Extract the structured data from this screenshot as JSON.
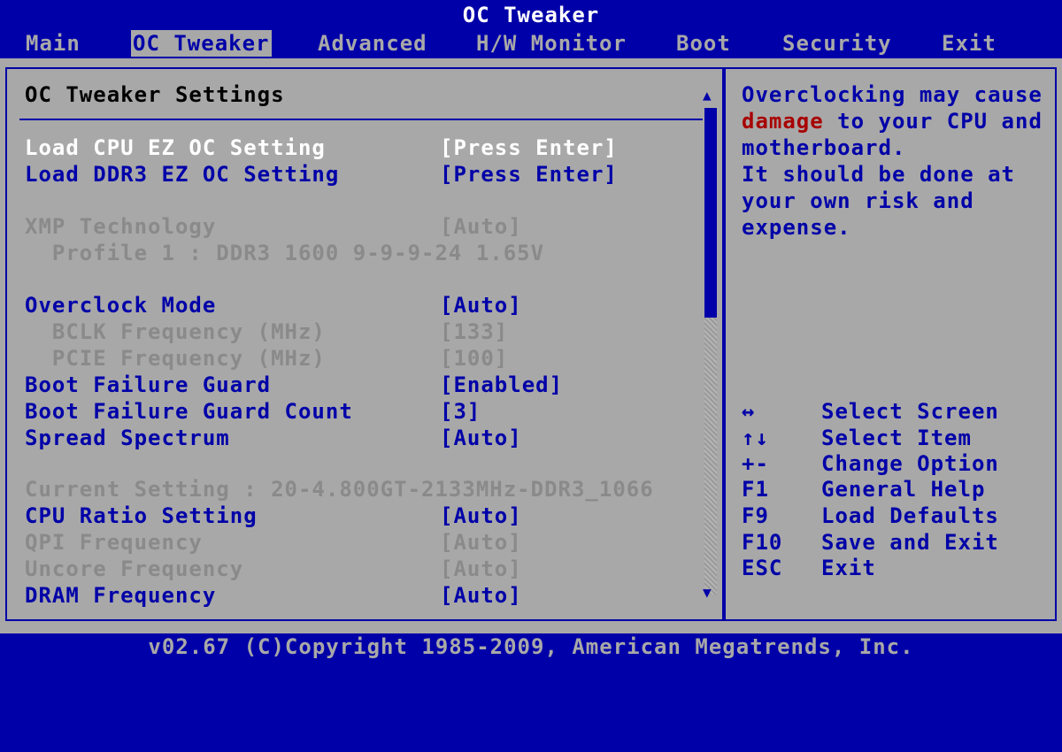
{
  "title": "OC Tweaker",
  "menu": [
    {
      "label": "Main",
      "active": false
    },
    {
      "label": "OC Tweaker",
      "active": true
    },
    {
      "label": "Advanced",
      "active": false
    },
    {
      "label": "H/W Monitor",
      "active": false
    },
    {
      "label": "Boot",
      "active": false
    },
    {
      "label": "Security",
      "active": false
    },
    {
      "label": "Exit",
      "active": false
    }
  ],
  "section_title": "OC Tweaker Settings",
  "settings": [
    {
      "label": "Load CPU EZ OC Setting",
      "value": "[Press Enter]",
      "state": "selected"
    },
    {
      "label": "Load DDR3 EZ OC Setting",
      "value": "[Press Enter]",
      "state": "enabled"
    },
    {
      "label": "XMP Technology",
      "value": "[Auto]",
      "state": "disabled"
    },
    {
      "label": "  Profile 1 : DDR3 1600 9-9-9-24 1.65V",
      "value": "",
      "state": "disabled"
    },
    {
      "label": "Overclock Mode",
      "value": "[Auto]",
      "state": "enabled"
    },
    {
      "label": "  BCLK Frequency (MHz)",
      "value": "[133]",
      "state": "disabled"
    },
    {
      "label": "  PCIE Frequency (MHz)",
      "value": "[100]",
      "state": "disabled"
    },
    {
      "label": "Boot Failure Guard",
      "value": "[Enabled]",
      "state": "enabled"
    },
    {
      "label": "Boot Failure Guard Count",
      "value": "[3]",
      "state": "enabled"
    },
    {
      "label": "Spread Spectrum",
      "value": "[Auto]",
      "state": "enabled"
    },
    {
      "label": "Current Setting : 20-4.800GT-2133MHz-DDR3_1066",
      "value": "",
      "state": "disabled"
    },
    {
      "label": "CPU Ratio Setting",
      "value": "[Auto]",
      "state": "enabled"
    },
    {
      "label": "QPI Frequency",
      "value": "[Auto]",
      "state": "disabled"
    },
    {
      "label": "Uncore Frequency",
      "value": "[Auto]",
      "state": "disabled"
    },
    {
      "label": "DRAM Frequency",
      "value": "[Auto]",
      "state": "enabled"
    }
  ],
  "help": {
    "line1": "Overclocking may cause",
    "line2_red": "damage",
    "line2_rest": " to your CPU and",
    "line3": "motherboard.",
    "line4": "It should be done at",
    "line5": "your own risk and",
    "line6": "expense."
  },
  "keys": [
    {
      "key": "↔",
      "desc": "Select Screen"
    },
    {
      "key": "↑↓",
      "desc": "Select Item"
    },
    {
      "key": "+-",
      "desc": "Change Option"
    },
    {
      "key": "F1",
      "desc": "General Help"
    },
    {
      "key": "F9",
      "desc": "Load Defaults"
    },
    {
      "key": "F10",
      "desc": "Save and Exit"
    },
    {
      "key": "ESC",
      "desc": "Exit"
    }
  ],
  "footer": "v02.67 (C)Copyright 1985-2009, American Megatrends, Inc.",
  "colors": {
    "background": "#0000a8",
    "panel": "#a8a8a8",
    "selected": "#ffffff",
    "disabled": "#8a8a8a",
    "warning": "#a80000"
  },
  "scroll_position": 0.43
}
